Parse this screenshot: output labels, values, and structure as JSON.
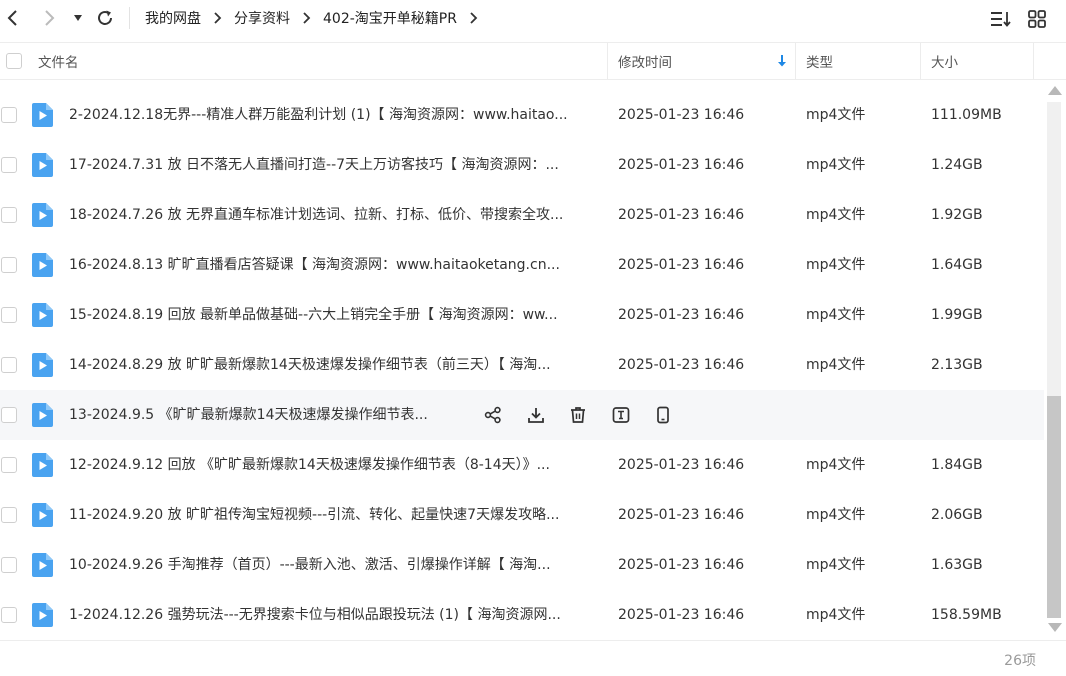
{
  "breadcrumb": [
    "我的网盘",
    "分享资料",
    "402-淘宝开单秘籍PR"
  ],
  "columns": {
    "name": "文件名",
    "modified": "修改时间",
    "type": "类型",
    "size": "大小"
  },
  "files": [
    {
      "name": "2-2024.12.18无界---精准人群万能盈利计划 (1)【 海淘资源网：www.haitao...",
      "date": "2025-01-23 16:46",
      "type": "mp4文件",
      "size": "111.09MB"
    },
    {
      "name": "17-2024.7.31 放 日不落无人直播间打造--7天上万访客技巧【 海淘资源网：...",
      "date": "2025-01-23 16:46",
      "type": "mp4文件",
      "size": "1.24GB"
    },
    {
      "name": "18-2024.7.26 放 无界直通车标准计划选词、拉新、打标、低价、带搜索全攻...",
      "date": "2025-01-23 16:46",
      "type": "mp4文件",
      "size": "1.92GB"
    },
    {
      "name": "16-2024.8.13 旷旷直播看店答疑课【 海淘资源网：www.haitaoketang.cn...",
      "date": "2025-01-23 16:46",
      "type": "mp4文件",
      "size": "1.64GB"
    },
    {
      "name": "15-2024.8.19 回放 最新单品做基础--六大上销完全手册【 海淘资源网：ww...",
      "date": "2025-01-23 16:46",
      "type": "mp4文件",
      "size": "1.99GB"
    },
    {
      "name": "14-2024.8.29 放 旷旷最新爆款14天极速爆发操作细节表（前三天）【 海淘...",
      "date": "2025-01-23 16:46",
      "type": "mp4文件",
      "size": "2.13GB"
    },
    {
      "name": "13-2024.9.5 《旷旷最新爆款14天极速爆发操作细节表...",
      "date": "",
      "type": "",
      "size": ""
    },
    {
      "name": "12-2024.9.12 回放 《旷旷最新爆款14天极速爆发操作细节表（8-14天）》...",
      "date": "2025-01-23 16:46",
      "type": "mp4文件",
      "size": "1.84GB"
    },
    {
      "name": "11-2024.9.20 放 旷旷祖传淘宝短视频---引流、转化、起量快速7天爆发攻略...",
      "date": "2025-01-23 16:46",
      "type": "mp4文件",
      "size": "2.06GB"
    },
    {
      "name": "10-2024.9.26 手淘推荐（首页）---最新入池、激活、引爆操作详解【 海淘...",
      "date": "2025-01-23 16:46",
      "type": "mp4文件",
      "size": "1.63GB"
    },
    {
      "name": "1-2024.12.26 强势玩法---无界搜索卡位与相似品跟投玩法 (1)【 海淘资源网...",
      "date": "2025-01-23 16:46",
      "type": "mp4文件",
      "size": "158.59MB"
    }
  ],
  "item_count": "26项",
  "icons": {
    "back": "chevron-left-icon",
    "forward": "chevron-right-icon",
    "history": "caret-down-icon",
    "refresh": "refresh-icon",
    "sort": "sort-list-icon",
    "grid": "grid-view-icon",
    "file": "video-file-icon",
    "share": "share-icon",
    "download": "download-icon",
    "delete": "trash-icon",
    "rename": "rename-icon",
    "phone": "send-to-phone-icon"
  },
  "colors": {
    "accent": "#1e88e5",
    "file_icon": "#4aa3f0",
    "hover_row": "#f6f7f9"
  }
}
